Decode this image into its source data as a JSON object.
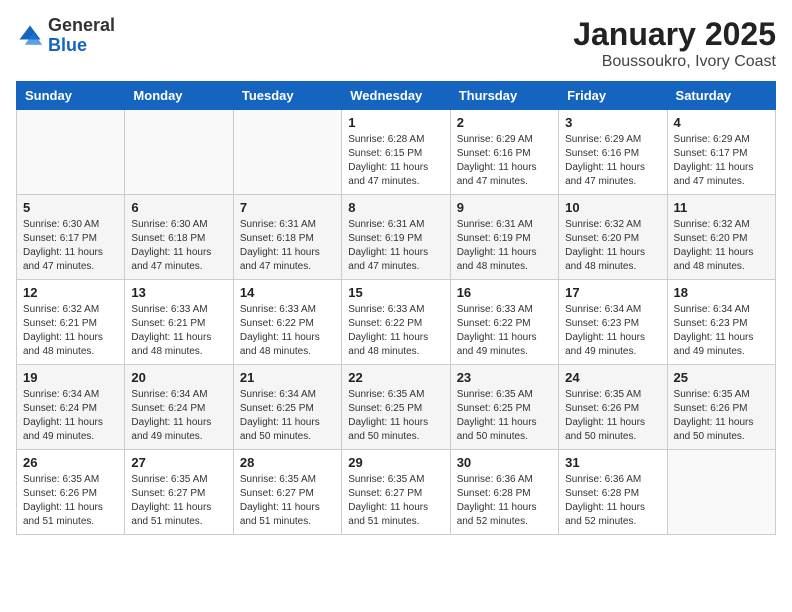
{
  "header": {
    "logo_general": "General",
    "logo_blue": "Blue",
    "month_title": "January 2025",
    "location": "Boussoukro, Ivory Coast"
  },
  "days_of_week": [
    "Sunday",
    "Monday",
    "Tuesday",
    "Wednesday",
    "Thursday",
    "Friday",
    "Saturday"
  ],
  "weeks": [
    [
      {
        "day": "",
        "info": ""
      },
      {
        "day": "",
        "info": ""
      },
      {
        "day": "",
        "info": ""
      },
      {
        "day": "1",
        "info": "Sunrise: 6:28 AM\nSunset: 6:15 PM\nDaylight: 11 hours and 47 minutes."
      },
      {
        "day": "2",
        "info": "Sunrise: 6:29 AM\nSunset: 6:16 PM\nDaylight: 11 hours and 47 minutes."
      },
      {
        "day": "3",
        "info": "Sunrise: 6:29 AM\nSunset: 6:16 PM\nDaylight: 11 hours and 47 minutes."
      },
      {
        "day": "4",
        "info": "Sunrise: 6:29 AM\nSunset: 6:17 PM\nDaylight: 11 hours and 47 minutes."
      }
    ],
    [
      {
        "day": "5",
        "info": "Sunrise: 6:30 AM\nSunset: 6:17 PM\nDaylight: 11 hours and 47 minutes."
      },
      {
        "day": "6",
        "info": "Sunrise: 6:30 AM\nSunset: 6:18 PM\nDaylight: 11 hours and 47 minutes."
      },
      {
        "day": "7",
        "info": "Sunrise: 6:31 AM\nSunset: 6:18 PM\nDaylight: 11 hours and 47 minutes."
      },
      {
        "day": "8",
        "info": "Sunrise: 6:31 AM\nSunset: 6:19 PM\nDaylight: 11 hours and 47 minutes."
      },
      {
        "day": "9",
        "info": "Sunrise: 6:31 AM\nSunset: 6:19 PM\nDaylight: 11 hours and 48 minutes."
      },
      {
        "day": "10",
        "info": "Sunrise: 6:32 AM\nSunset: 6:20 PM\nDaylight: 11 hours and 48 minutes."
      },
      {
        "day": "11",
        "info": "Sunrise: 6:32 AM\nSunset: 6:20 PM\nDaylight: 11 hours and 48 minutes."
      }
    ],
    [
      {
        "day": "12",
        "info": "Sunrise: 6:32 AM\nSunset: 6:21 PM\nDaylight: 11 hours and 48 minutes."
      },
      {
        "day": "13",
        "info": "Sunrise: 6:33 AM\nSunset: 6:21 PM\nDaylight: 11 hours and 48 minutes."
      },
      {
        "day": "14",
        "info": "Sunrise: 6:33 AM\nSunset: 6:22 PM\nDaylight: 11 hours and 48 minutes."
      },
      {
        "day": "15",
        "info": "Sunrise: 6:33 AM\nSunset: 6:22 PM\nDaylight: 11 hours and 48 minutes."
      },
      {
        "day": "16",
        "info": "Sunrise: 6:33 AM\nSunset: 6:22 PM\nDaylight: 11 hours and 49 minutes."
      },
      {
        "day": "17",
        "info": "Sunrise: 6:34 AM\nSunset: 6:23 PM\nDaylight: 11 hours and 49 minutes."
      },
      {
        "day": "18",
        "info": "Sunrise: 6:34 AM\nSunset: 6:23 PM\nDaylight: 11 hours and 49 minutes."
      }
    ],
    [
      {
        "day": "19",
        "info": "Sunrise: 6:34 AM\nSunset: 6:24 PM\nDaylight: 11 hours and 49 minutes."
      },
      {
        "day": "20",
        "info": "Sunrise: 6:34 AM\nSunset: 6:24 PM\nDaylight: 11 hours and 49 minutes."
      },
      {
        "day": "21",
        "info": "Sunrise: 6:34 AM\nSunset: 6:25 PM\nDaylight: 11 hours and 50 minutes."
      },
      {
        "day": "22",
        "info": "Sunrise: 6:35 AM\nSunset: 6:25 PM\nDaylight: 11 hours and 50 minutes."
      },
      {
        "day": "23",
        "info": "Sunrise: 6:35 AM\nSunset: 6:25 PM\nDaylight: 11 hours and 50 minutes."
      },
      {
        "day": "24",
        "info": "Sunrise: 6:35 AM\nSunset: 6:26 PM\nDaylight: 11 hours and 50 minutes."
      },
      {
        "day": "25",
        "info": "Sunrise: 6:35 AM\nSunset: 6:26 PM\nDaylight: 11 hours and 50 minutes."
      }
    ],
    [
      {
        "day": "26",
        "info": "Sunrise: 6:35 AM\nSunset: 6:26 PM\nDaylight: 11 hours and 51 minutes."
      },
      {
        "day": "27",
        "info": "Sunrise: 6:35 AM\nSunset: 6:27 PM\nDaylight: 11 hours and 51 minutes."
      },
      {
        "day": "28",
        "info": "Sunrise: 6:35 AM\nSunset: 6:27 PM\nDaylight: 11 hours and 51 minutes."
      },
      {
        "day": "29",
        "info": "Sunrise: 6:35 AM\nSunset: 6:27 PM\nDaylight: 11 hours and 51 minutes."
      },
      {
        "day": "30",
        "info": "Sunrise: 6:36 AM\nSunset: 6:28 PM\nDaylight: 11 hours and 52 minutes."
      },
      {
        "day": "31",
        "info": "Sunrise: 6:36 AM\nSunset: 6:28 PM\nDaylight: 11 hours and 52 minutes."
      },
      {
        "day": "",
        "info": ""
      }
    ]
  ]
}
